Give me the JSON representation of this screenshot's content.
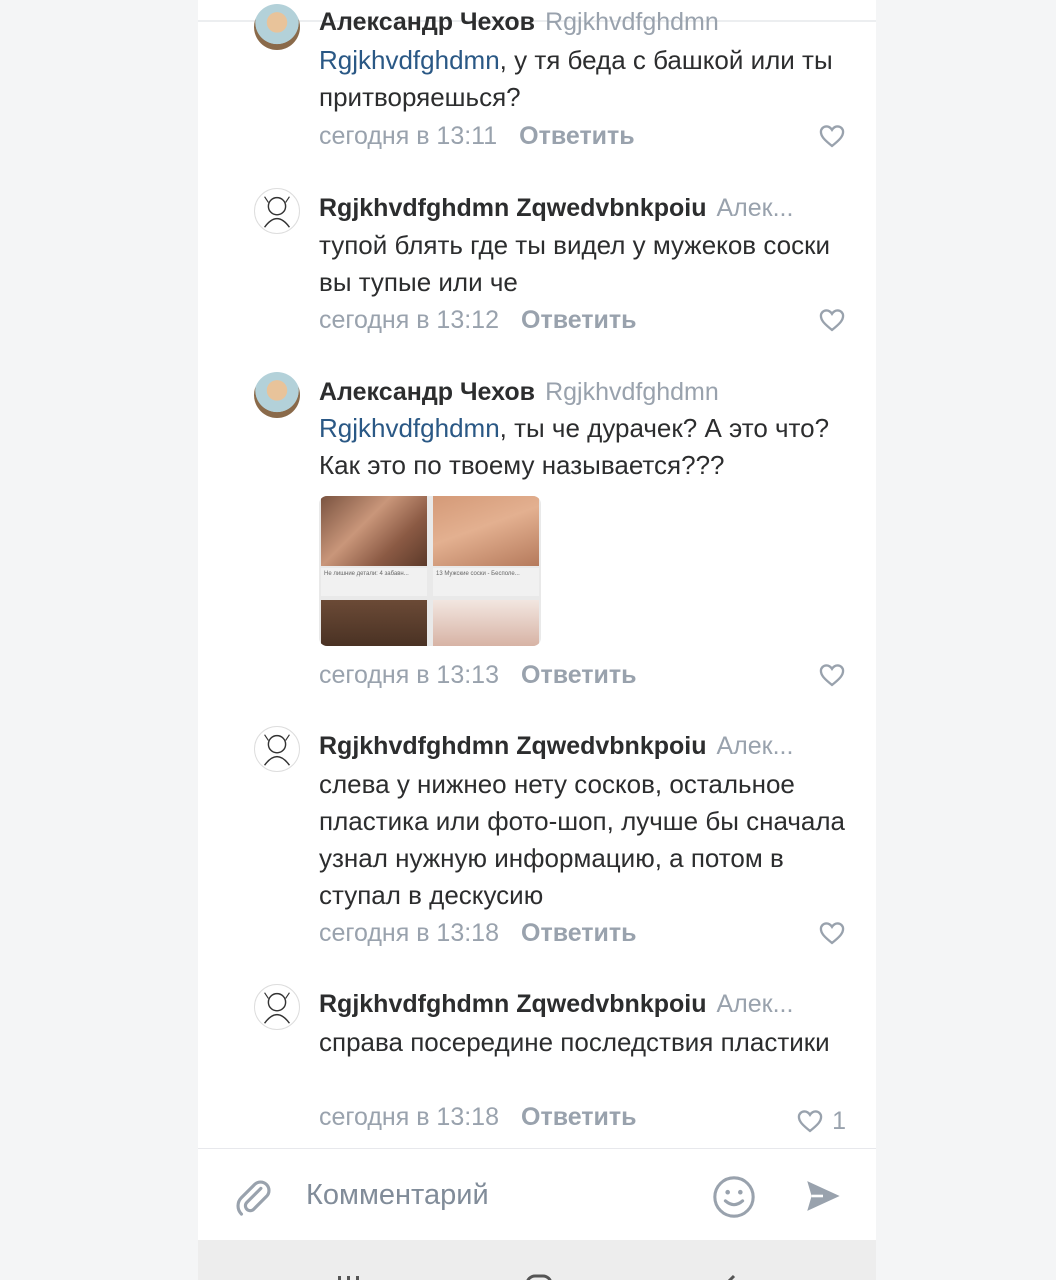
{
  "comments": [
    {
      "author": "Александр Чехов",
      "reply_to": "Rgjkhvdfghdmn",
      "mention": "Rgjkhvdfghdmn",
      "text_after_mention": ", у тя беда с башкой или ты притворяешься?",
      "time": "сегодня в 13:11",
      "reply_label": "Ответить",
      "likes": ""
    },
    {
      "author": "Rgjkhvdfghdmn Zqwedvbnkpoiu",
      "reply_to": "Алек...",
      "text": "тупой блять где ты видел у мужеков соски вы тупые или че",
      "time": "сегодня в 13:12",
      "reply_label": "Ответить",
      "likes": ""
    },
    {
      "author": "Александр Чехов",
      "reply_to": "Rgjkhvdfghdmn",
      "mention": "Rgjkhvdfghdmn",
      "text_after_mention": ", ты че дурачек?  А это что?  Как это по твоему называется???",
      "photo_captions": [
        "Не лишние детали: 4 забавн...",
        "13 Мужские соски - Бесполе..."
      ],
      "time": "сегодня в 13:13",
      "reply_label": "Ответить",
      "likes": ""
    },
    {
      "author": "Rgjkhvdfghdmn Zqwedvbnkpoiu",
      "reply_to": "Алек...",
      "text": "слева у нижнео нету сосков, остальное пластика или фото-шоп, лучше бы сначала узнал нужную информацию, а потом в ступал в дескусию",
      "time": "сегодня в 13:18",
      "reply_label": "Ответить",
      "likes": ""
    },
    {
      "author": "Rgjkhvdfghdmn Zqwedvbnkpoiu",
      "reply_to": "Алек...",
      "text": "справа посередине последствия пластики",
      "time": "сегодня в 13:18",
      "reply_label": "Ответить",
      "likes": "1"
    }
  ],
  "composer": {
    "placeholder": "Комментарий"
  },
  "colors": {
    "link": "#2a5885",
    "secondary": "#99a2ad",
    "text": "#2c2d2e"
  }
}
